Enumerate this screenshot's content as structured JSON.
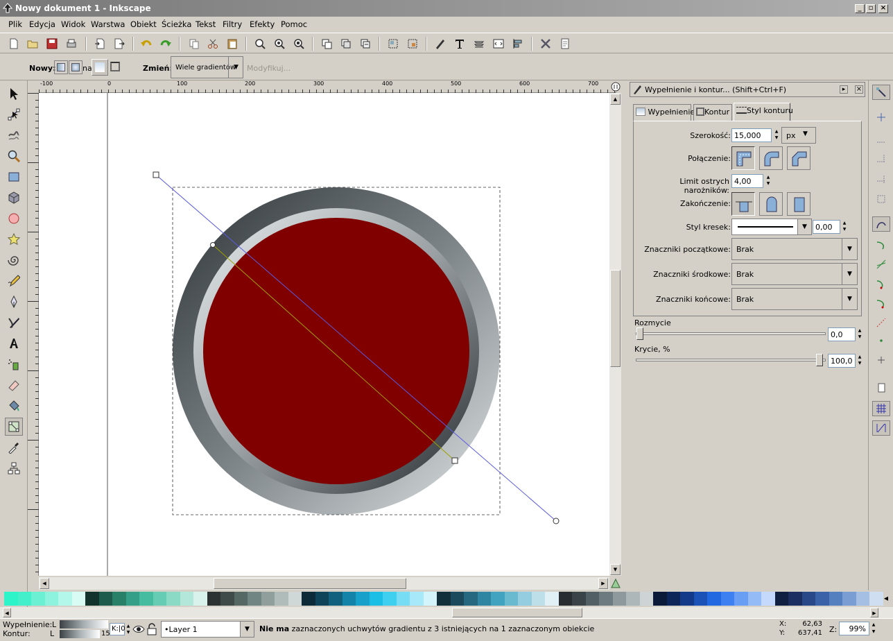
{
  "window": {
    "title": "Nowy dokument 1 - Inkscape"
  },
  "menu": [
    "Plik",
    "Edycja",
    "Widok",
    "Warstwa",
    "Obiekt",
    "Ścieżka",
    "Tekst",
    "Filtry",
    "Efekty",
    "Pomoc"
  ],
  "toolbar2": {
    "new_label": "Nowy:",
    "on_label": "na",
    "change_label": "Zmień:",
    "gradient_select": "Wiele gradientów",
    "edit_button": "Modyfikuj..."
  },
  "ruler": {
    "h_ticks": [
      "-100",
      "0",
      "100",
      "200",
      "300",
      "400",
      "500",
      "600",
      "700"
    ]
  },
  "panel": {
    "title": "Wypełnienie i kontur... (Shift+Ctrl+F)",
    "tabs": [
      "Wypełnienie",
      "Kontur",
      "Styl konturu"
    ],
    "width_label": "Szerokość:",
    "width_value": "15,000",
    "width_unit": "px",
    "join_label": "Połączenie:",
    "miter_label": "Limit ostrych narożników:",
    "miter_value": "4,00",
    "cap_label": "Zakończenie:",
    "dash_label": "Styl kresek:",
    "dash_offset": "0,00",
    "start_markers_label": "Znaczniki początkowe:",
    "start_markers_value": "Brak",
    "mid_markers_label": "Znaczniki środkowe:",
    "mid_markers_value": "Brak",
    "end_markers_label": "Znaczniki końcowe:",
    "end_markers_value": "Brak",
    "blur_label": "Rozmycie",
    "blur_value": "0,0",
    "opacity_label": "Krycie, %",
    "opacity_value": "100,0"
  },
  "status": {
    "fill_label": "Wypełnienie:",
    "stroke_label": "Kontur:",
    "fill_flag": "L",
    "stroke_flag": "L",
    "stroke_width": "15",
    "opacity_field": "K:|0",
    "layer": "•Layer 1",
    "message_bold": "Nie ma",
    "message": " zaznaczonych uchwytów gradientu z 3 istniejących na 1 zaznaczonym obiekcie",
    "x_label": "X:",
    "x_value": "62,63",
    "y_label": "Y:",
    "y_value": "637,41",
    "zoom_label": "Z:",
    "zoom_value": "99%"
  },
  "palette": [
    "#2ef5c9",
    "#44f0cc",
    "#6cf0d4",
    "#8df2de",
    "#b3f7ea",
    "#d8fbf4",
    "#12332b",
    "#1d5c4c",
    "#288068",
    "#35a087",
    "#45bca0",
    "#66ccb3",
    "#8adac6",
    "#b2e7da",
    "#d9f3ec",
    "#2b3231",
    "#3e4b48",
    "#566864",
    "#718682",
    "#909f9c",
    "#b0bcba",
    "#d0d8d7",
    "#0c2a38",
    "#0f4458",
    "#11617e",
    "#1383a8",
    "#17a0c9",
    "#1bbfe5",
    "#3fd0f0",
    "#76ddf5",
    "#a8e9f9",
    "#d4f4fc",
    "#12303c",
    "#1b4a5c",
    "#256880",
    "#2f86a3",
    "#41a3bf",
    "#69b9cf",
    "#94cddf",
    "#bddfea",
    "#e1f0f5",
    "#272d30",
    "#3a4448",
    "#525f64",
    "#6d7b80",
    "#8d999d",
    "#adb7ba",
    "#ced4d6",
    "#0a1a38",
    "#0d2558",
    "#123a88",
    "#1a52b8",
    "#2268e0",
    "#3c80f2",
    "#689ff5",
    "#95bbf7",
    "#c4d9fb",
    "#102040",
    "#1b3060",
    "#294888",
    "#3a62a8",
    "#5580c0",
    "#7a9ed3",
    "#a4bfe2",
    "#cfdef0"
  ]
}
